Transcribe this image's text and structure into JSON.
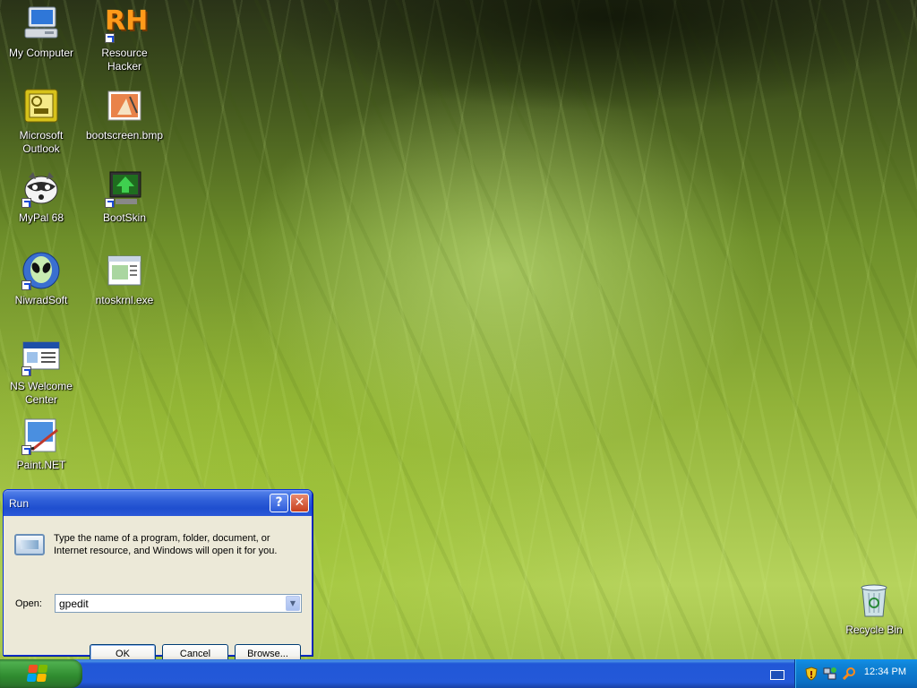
{
  "desktop": {
    "icons": [
      {
        "label": "My Computer"
      },
      {
        "label": "Resource Hacker",
        "logo_text": "RH"
      },
      {
        "label": "Microsoft Outlook"
      },
      {
        "label": "bootscreen.bmp"
      },
      {
        "label": "MyPal 68"
      },
      {
        "label": "BootSkin"
      },
      {
        "label": "NiwradSoft"
      },
      {
        "label": "ntoskrnl.exe"
      },
      {
        "label": "NS Welcome Center"
      },
      {
        "label": "Paint.NET"
      },
      {
        "label": "Recycle Bin"
      }
    ]
  },
  "run_dialog": {
    "title": "Run",
    "help_glyph": "?",
    "close_glyph": "✕",
    "description": "Type the name of a program, folder, document, or Internet resource, and Windows will open it for you.",
    "open_label": "Open:",
    "open_value": "gpedit",
    "ok_label": "OK",
    "cancel_label": "Cancel",
    "browse_label": "Browse..."
  },
  "taskbar": {
    "clock": "12:34 PM",
    "tray_icons": [
      "keyboard-icon",
      "security-shield-icon",
      "network-icon",
      "search-icon"
    ]
  },
  "colors": {
    "titlebar": "#2f5fd8",
    "taskbar": "#2459d8",
    "start_button": "#2f8b2f",
    "dialog_bg": "#ece9d8"
  }
}
